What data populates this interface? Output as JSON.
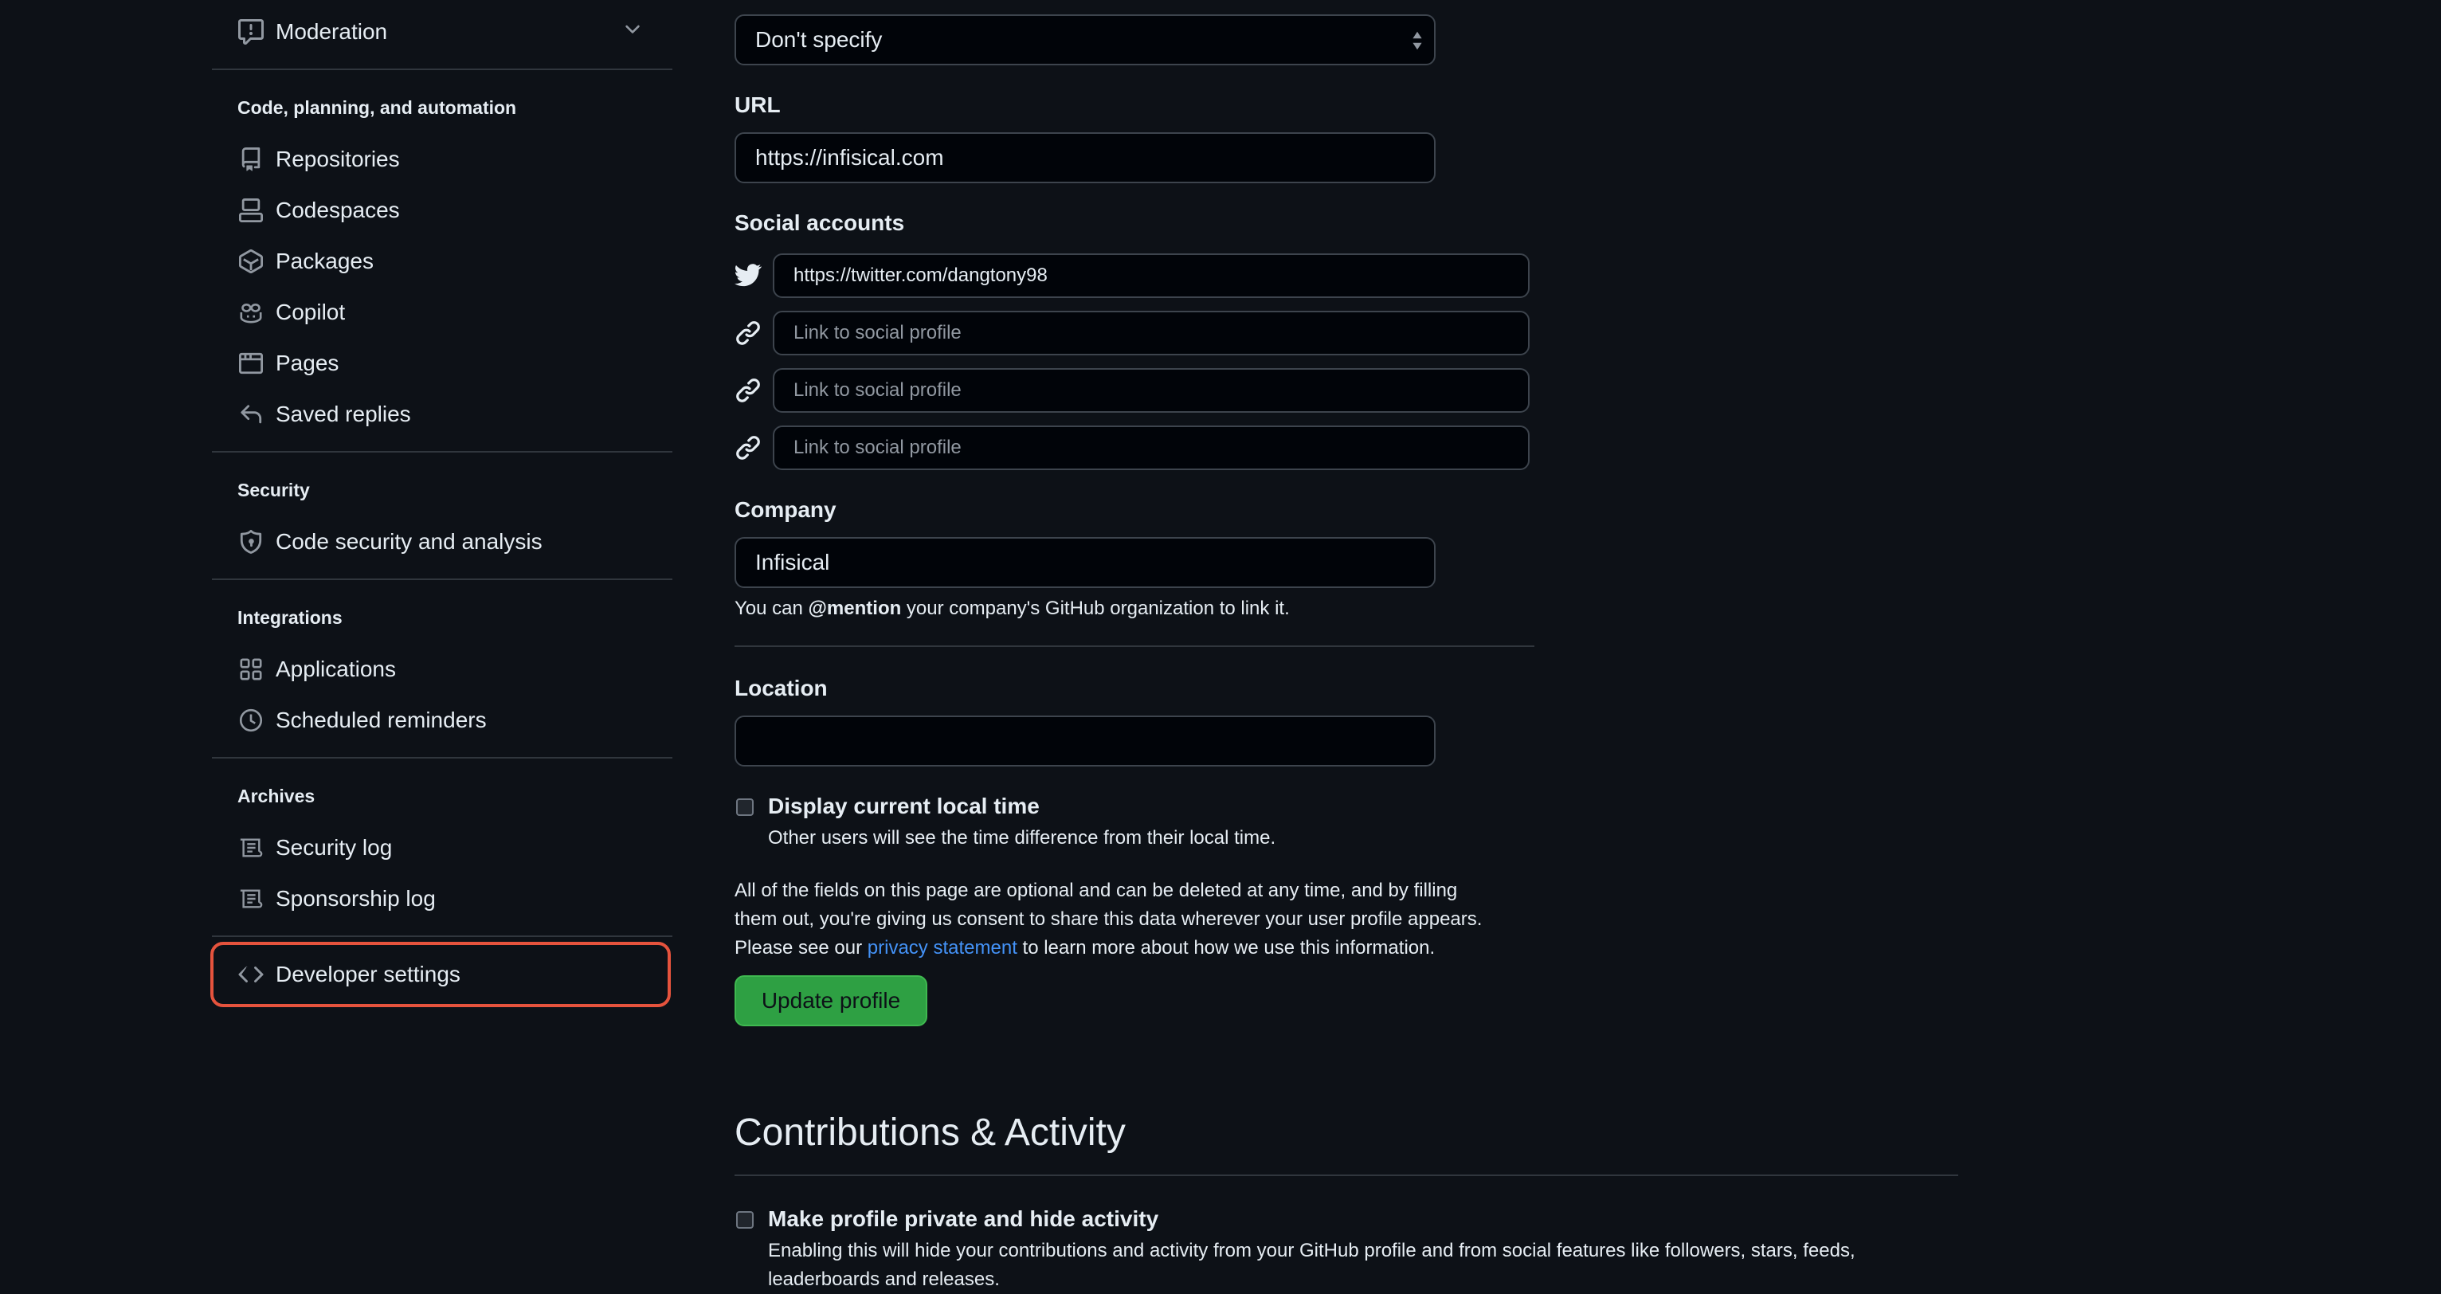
{
  "sidebar": {
    "moderation": "Moderation",
    "sections": [
      {
        "title": "Code, planning, and automation",
        "items": [
          "Repositories",
          "Codespaces",
          "Packages",
          "Copilot",
          "Pages",
          "Saved replies"
        ]
      },
      {
        "title": "Security",
        "items": [
          "Code security and analysis"
        ]
      },
      {
        "title": "Integrations",
        "items": [
          "Applications",
          "Scheduled reminders"
        ]
      },
      {
        "title": "Archives",
        "items": [
          "Security log",
          "Sponsorship log"
        ]
      }
    ],
    "developer_settings": "Developer settings"
  },
  "form": {
    "pronouns_value": "Don't specify",
    "url_label": "URL",
    "url_value": "https://infisical.com",
    "social_label": "Social accounts",
    "social_links": [
      "https://twitter.com/dangtony98",
      "",
      "",
      ""
    ],
    "social_placeholder": "Link to social profile",
    "company_label": "Company",
    "company_value": "Infisical",
    "company_note_prefix": "You can ",
    "company_note_mention": "@mention",
    "company_note_suffix": " your company's GitHub organization to link it.",
    "location_label": "Location",
    "location_value": "",
    "local_time_label": "Display current local time",
    "local_time_desc": "Other users will see the time difference from their local time.",
    "privacy_line1": "All of the fields on this page are optional and can be deleted at any time, and by filling",
    "privacy_line2": "them out, you're giving us consent to share this data wherever your user profile appears.",
    "privacy_line3_prefix": "Please see our ",
    "privacy_link": "privacy statement",
    "privacy_line3_suffix": " to learn more about how we use this information.",
    "update_button": "Update profile"
  },
  "contributions": {
    "heading": "Contributions & Activity",
    "private_label": "Make profile private and hide activity",
    "private_desc_line1": "Enabling this will hide your contributions and activity from your GitHub profile and from social features like followers, stars, feeds,",
    "private_desc_line2": "leaderboards and releases."
  },
  "colors": {
    "background": "#0d1117",
    "accent_green": "#2ea043",
    "link_blue": "#4493f8",
    "highlight_red": "#e5533d"
  },
  "icons": {
    "moderation": "report-icon",
    "repositories": "repo-icon",
    "codespaces": "codespaces-icon",
    "packages": "package-icon",
    "copilot": "copilot-icon",
    "pages": "browser-icon",
    "saved_replies": "reply-icon",
    "code_security": "shield-icon",
    "applications": "apps-icon",
    "scheduled_reminders": "clock-icon",
    "security_log": "log-icon",
    "sponsorship_log": "log-icon",
    "developer_settings": "code-icon",
    "twitter": "twitter-icon",
    "link": "link-icon"
  }
}
